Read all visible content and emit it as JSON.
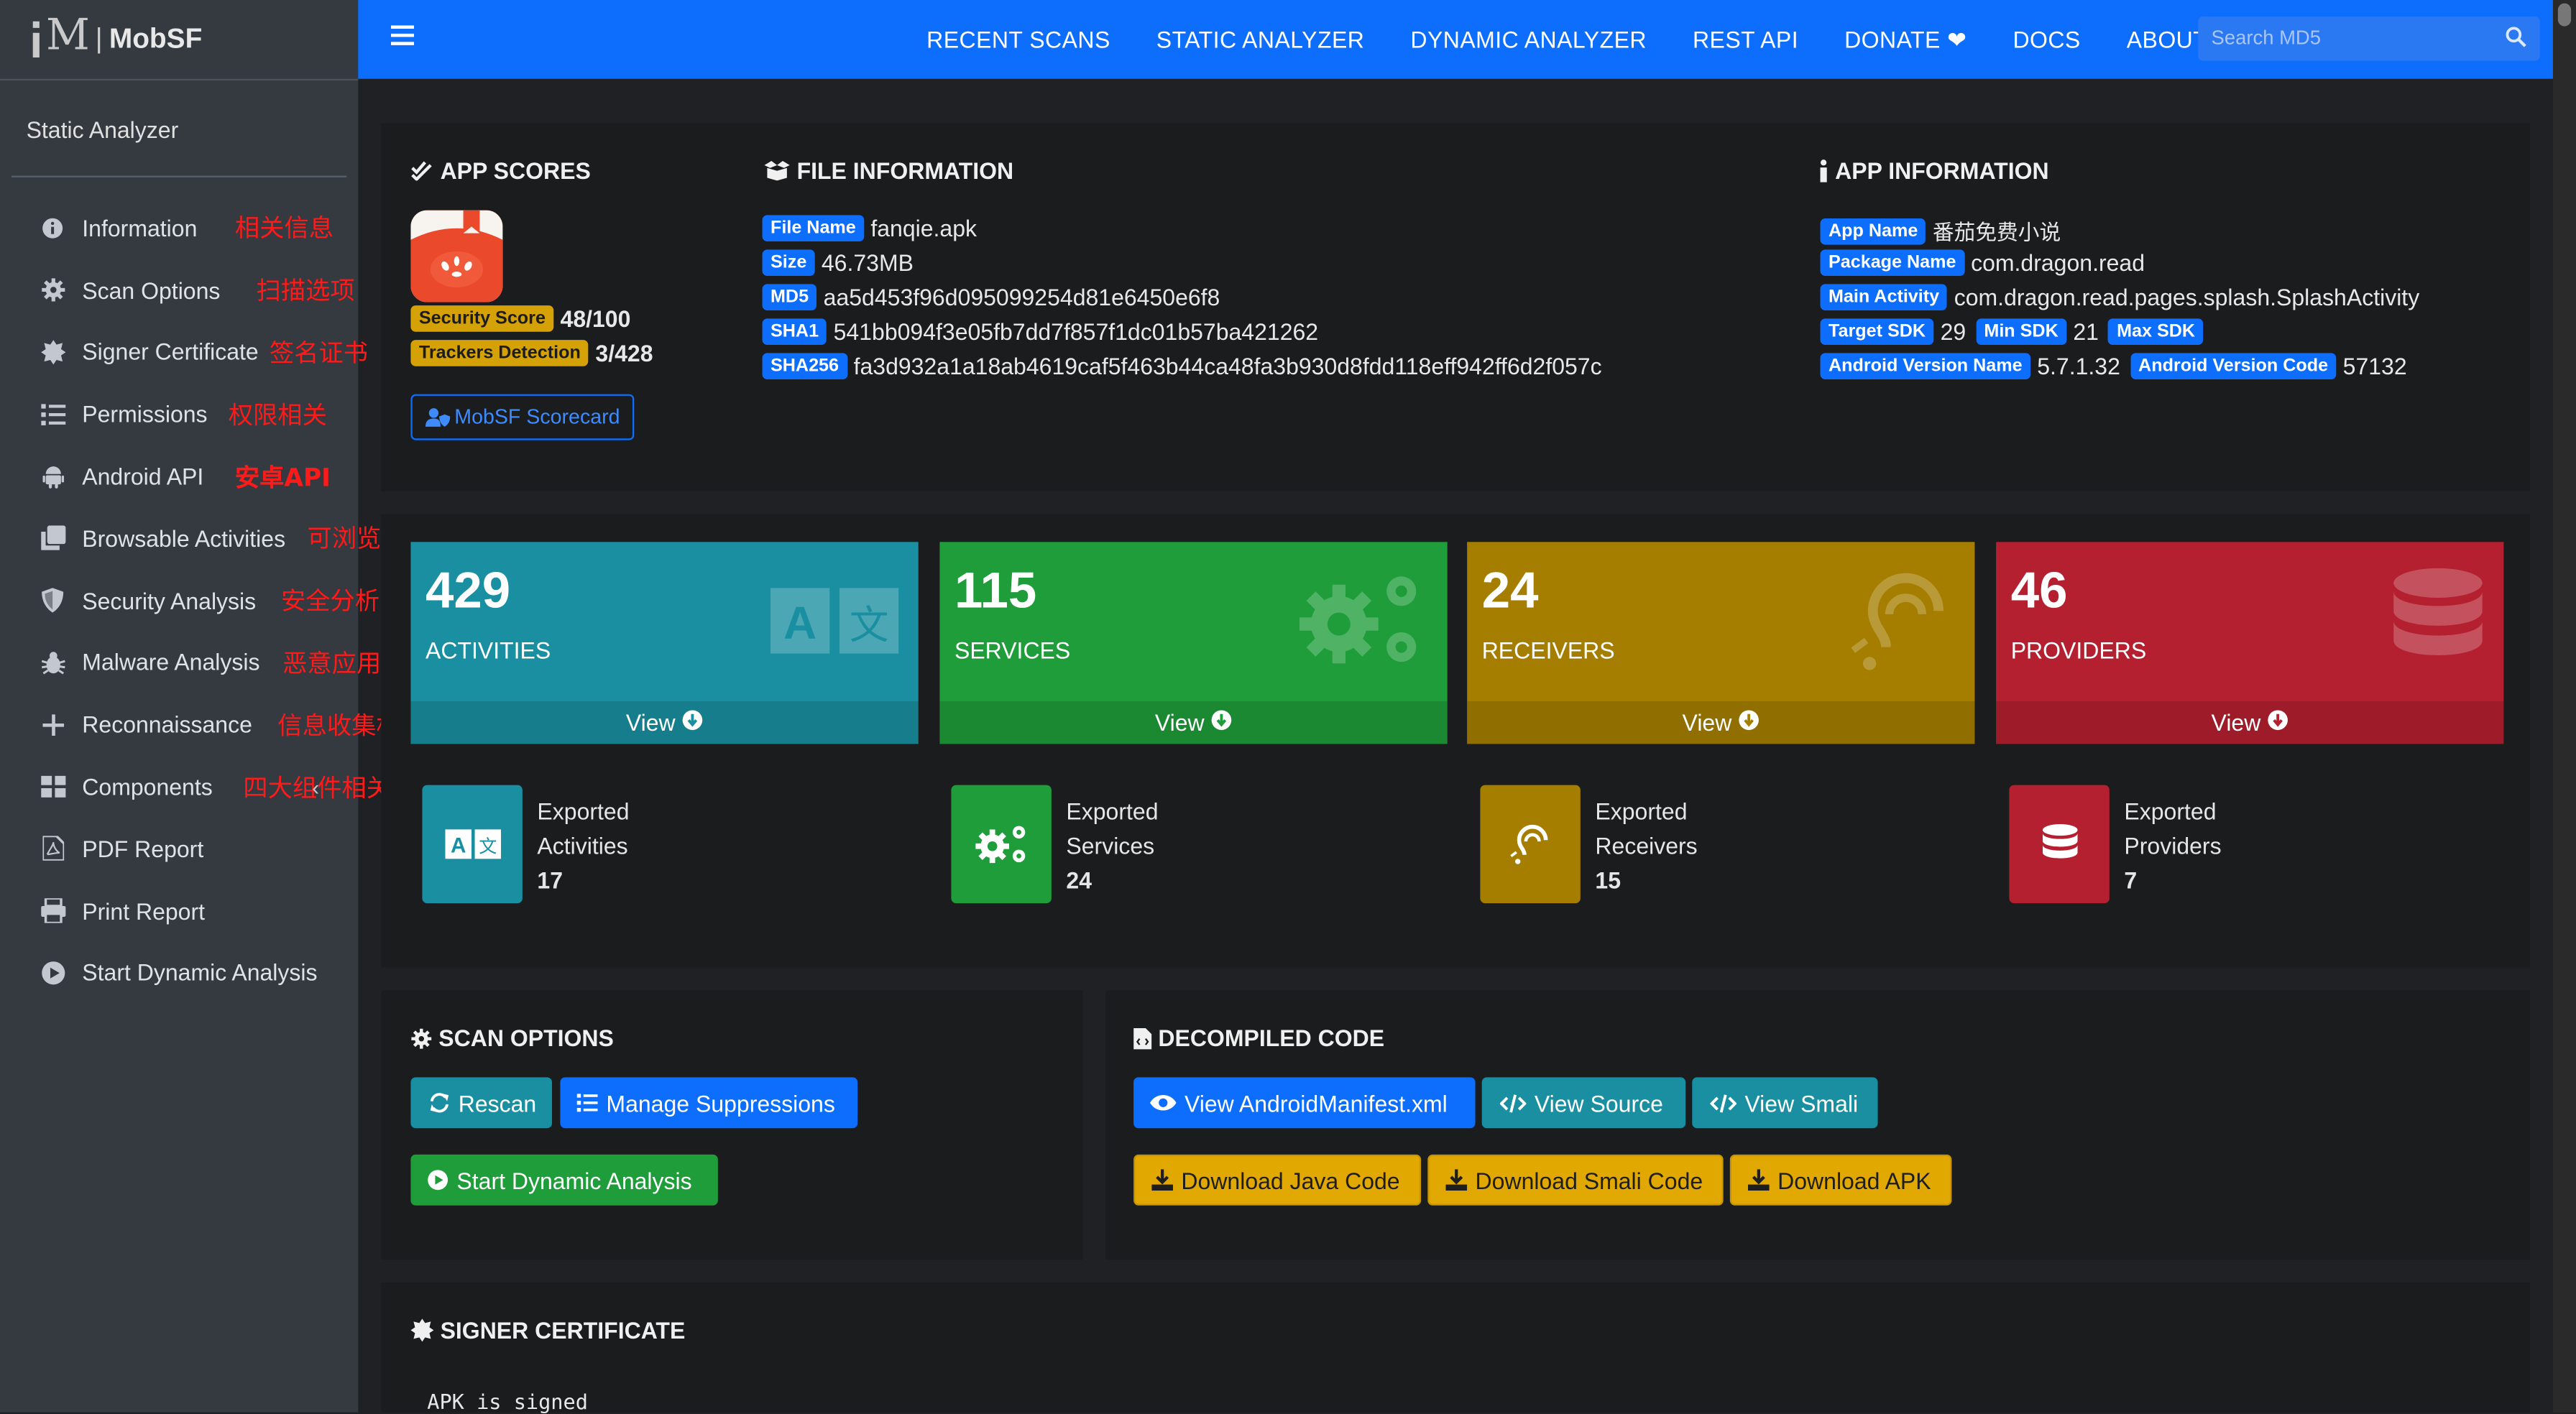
{
  "brand": {
    "name": "MobSF",
    "pipe": "|"
  },
  "sidebar": {
    "title": "Static Analyzer",
    "items": [
      {
        "label": "Information",
        "icon": "info-circle-icon",
        "note": "相关信息"
      },
      {
        "label": "Scan Options",
        "icon": "gear-icon",
        "note": "扫描选项"
      },
      {
        "label": "Signer Certificate",
        "icon": "certificate-icon",
        "note": "签名证书"
      },
      {
        "label": "Permissions",
        "icon": "list-icon",
        "note": "权限相关"
      },
      {
        "label": "Android API",
        "icon": "android-icon",
        "note": "安卓API"
      },
      {
        "label": "Browsable Activities",
        "icon": "clone-icon",
        "note": "可浏览Activity"
      },
      {
        "label": "Security Analysis",
        "icon": "shield-icon",
        "note": "安全分析"
      },
      {
        "label": "Malware Analysis",
        "icon": "bug-icon",
        "note": "恶意应用分析"
      },
      {
        "label": "Reconnaissance",
        "icon": "plus-icon",
        "note": "信息收集相关"
      },
      {
        "label": "Components",
        "icon": "grid-icon",
        "note": "四大组件相关"
      },
      {
        "label": "PDF Report",
        "icon": "pdf-icon",
        "note": ""
      },
      {
        "label": "Print Report",
        "icon": "print-icon",
        "note": ""
      },
      {
        "label": "Start Dynamic Analysis",
        "icon": "play-circle-icon",
        "note": ""
      }
    ]
  },
  "nav": {
    "links": [
      "RECENT SCANS",
      "STATIC ANALYZER",
      "DYNAMIC ANALYZER",
      "REST API",
      "DONATE",
      "DOCS",
      "ABOUT"
    ],
    "search_placeholder": "Search MD5"
  },
  "app_scores": {
    "title": "APP SCORES",
    "security_score_label": "Security Score",
    "security_score": "48/100",
    "trackers_label": "Trackers Detection",
    "trackers": "3/428",
    "scorecard_button": "MobSF Scorecard"
  },
  "file_info": {
    "title": "FILE INFORMATION",
    "rows": [
      {
        "label": "File Name",
        "value": "fanqie.apk"
      },
      {
        "label": "Size",
        "value": "46.73MB"
      },
      {
        "label": "MD5",
        "value": "aa5d453f96d095099254d81e6450e6f8"
      },
      {
        "label": "SHA1",
        "value": "541bb094f3e05fb7dd7f857f1dc01b57ba421262"
      },
      {
        "label": "SHA256",
        "value": "fa3d932a1a18ab4619caf5f463b44ca48fa3b930d8fdd118eff942ff6d2f057c"
      }
    ]
  },
  "app_info": {
    "title": "APP INFORMATION",
    "app_name_label": "App Name",
    "app_name": "番茄免费小说",
    "package_label": "Package Name",
    "package": "com.dragon.read",
    "main_activity_label": "Main Activity",
    "main_activity": "com.dragon.read.pages.splash.SplashActivity",
    "target_sdk_label": "Target SDK",
    "target_sdk": "29",
    "min_sdk_label": "Min SDK",
    "min_sdk": "21",
    "max_sdk_label": "Max SDK",
    "max_sdk": "",
    "version_name_label": "Android Version Name",
    "version_name": "5.7.1.32",
    "version_code_label": "Android Version Code",
    "version_code": "57132"
  },
  "stats": [
    {
      "count": "429",
      "label": "ACTIVITIES",
      "view": "View",
      "color": "#1a8fa1",
      "icon": "language-icon"
    },
    {
      "count": "115",
      "label": "SERVICES",
      "view": "View",
      "color": "#1f9d3a",
      "icon": "cogs-icon"
    },
    {
      "count": "24",
      "label": "RECEIVERS",
      "view": "View",
      "color": "#a57e00",
      "icon": "ear-icon"
    },
    {
      "count": "46",
      "label": "PROVIDERS",
      "view": "View",
      "color": "#b42030",
      "icon": "database-icon"
    }
  ],
  "exported": [
    {
      "line1": "Exported",
      "line2": "Activities",
      "value": "17",
      "color": "#1a8fa1",
      "icon": "language-icon"
    },
    {
      "line1": "Exported",
      "line2": "Services",
      "value": "24",
      "color": "#1f9d3a",
      "icon": "cogs-icon"
    },
    {
      "line1": "Exported",
      "line2": "Receivers",
      "value": "15",
      "color": "#a57e00",
      "icon": "ear-icon"
    },
    {
      "line1": "Exported",
      "line2": "Providers",
      "value": "7",
      "color": "#b42030",
      "icon": "database-icon"
    }
  ],
  "scan_options": {
    "title": "SCAN OPTIONS",
    "rescan": "Rescan",
    "manage_suppressions": "Manage Suppressions",
    "start_dynamic": "Start Dynamic Analysis"
  },
  "decompiled": {
    "title": "DECOMPILED CODE",
    "view_manifest": "View AndroidManifest.xml",
    "view_source": "View Source",
    "view_smali": "View Smali",
    "download_java": "Download Java Code",
    "download_smali": "Download Smali Code",
    "download_apk": "Download APK"
  },
  "signer": {
    "title": "SIGNER CERTIFICATE",
    "text": "APK is signed"
  }
}
